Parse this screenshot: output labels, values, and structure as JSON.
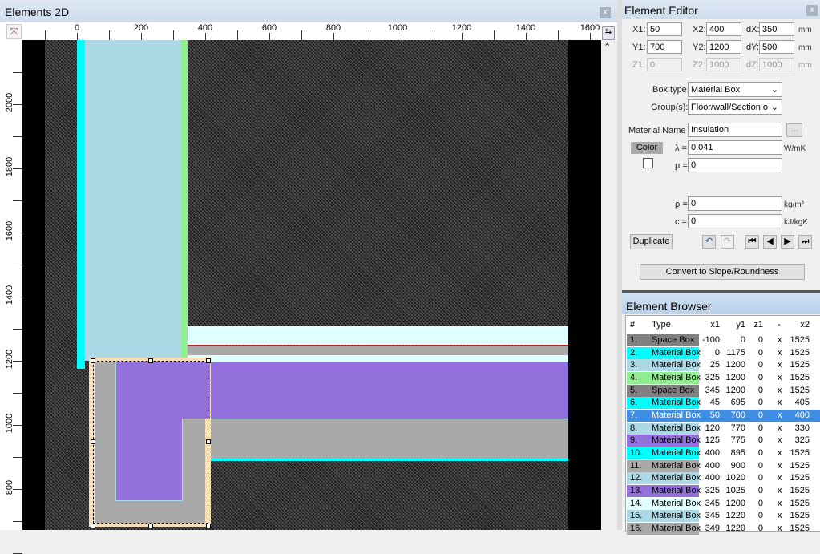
{
  "left_panel": {
    "title": "Elements 2D",
    "close": "x"
  },
  "ruler_x": [
    "0",
    "200",
    "400",
    "600",
    "800",
    "1000",
    "1200",
    "1400",
    "1600"
  ],
  "ruler_y": [
    "2000",
    "1800",
    "1600",
    "1400",
    "1200",
    "1000",
    "800"
  ],
  "editor": {
    "title": "Element Editor",
    "close": "x",
    "x1_label": "X1:",
    "x1": "50",
    "x2_label": "X2:",
    "x2": "400",
    "dx_label": "dX:",
    "dx": "350",
    "y1_label": "Y1:",
    "y1": "700",
    "y2_label": "Y2:",
    "y2": "1200",
    "dy_label": "dY:",
    "dy": "500",
    "z1_label": "Z1:",
    "z1": "0",
    "z2_label": "Z2:",
    "z2": "1000",
    "dz_label": "dZ:",
    "dz": "1000",
    "unit_mm": "mm",
    "box_type_label": "Box type:",
    "box_type": "Material Box",
    "groups_label": "Group(s):",
    "groups": "Floor/wall/Section ove",
    "material_name_label": "Material Name :",
    "material_name": "Insulation",
    "browse": "...",
    "color_button": "Color",
    "lambda_label": "λ =",
    "lambda": "0,041",
    "lambda_unit": "W/mK",
    "mu_label": "μ =",
    "mu": "0",
    "rho_label": "ρ =",
    "rho": "0",
    "rho_unit": "kg/m³",
    "c_label": "c =",
    "c": "0",
    "c_unit": "kJ/kgK",
    "duplicate": "Duplicate",
    "convert": "Convert to Slope/Roundness"
  },
  "browser": {
    "title": "Element Browser",
    "headers": [
      "#",
      "Type",
      "x1",
      "y1",
      "z1",
      "-",
      "x2"
    ],
    "rows": [
      {
        "n": "1.",
        "type": "Space Box",
        "x1": "-100",
        "y1": "0",
        "z1": "0",
        "s": "x",
        "x2": "1525",
        "color": "#808080"
      },
      {
        "n": "2.",
        "type": "Material Box",
        "x1": "0",
        "y1": "1175",
        "z1": "0",
        "s": "x",
        "x2": "1525",
        "color": "#00ffff"
      },
      {
        "n": "3.",
        "type": "Material Box",
        "x1": "25",
        "y1": "1200",
        "z1": "0",
        "s": "x",
        "x2": "1525",
        "color": "#add8e6"
      },
      {
        "n": "4.",
        "type": "Material Box",
        "x1": "325",
        "y1": "1200",
        "z1": "0",
        "s": "x",
        "x2": "1525",
        "color": "#90ee90"
      },
      {
        "n": "5.",
        "type": "Space Box",
        "x1": "345",
        "y1": "1200",
        "z1": "0",
        "s": "x",
        "x2": "1525",
        "color": "#808080"
      },
      {
        "n": "6.",
        "type": "Material Box",
        "x1": "45",
        "y1": "695",
        "z1": "0",
        "s": "x",
        "x2": "405",
        "color": "#00ffff"
      },
      {
        "n": "7.",
        "type": "Material Box",
        "x1": "50",
        "y1": "700",
        "z1": "0",
        "s": "x",
        "x2": "400",
        "color": "#3f8ee6",
        "selected": true
      },
      {
        "n": "8.",
        "type": "Material Box",
        "x1": "120",
        "y1": "770",
        "z1": "0",
        "s": "x",
        "x2": "330",
        "color": "#add8e6"
      },
      {
        "n": "9.",
        "type": "Material Box",
        "x1": "125",
        "y1": "775",
        "z1": "0",
        "s": "x",
        "x2": "325",
        "color": "#9370db"
      },
      {
        "n": "10.",
        "type": "Material Box",
        "x1": "400",
        "y1": "895",
        "z1": "0",
        "s": "x",
        "x2": "1525",
        "color": "#00ffff"
      },
      {
        "n": "11.",
        "type": "Material Box",
        "x1": "400",
        "y1": "900",
        "z1": "0",
        "s": "x",
        "x2": "1525",
        "color": "#a9a9a9"
      },
      {
        "n": "12.",
        "type": "Material Box",
        "x1": "400",
        "y1": "1020",
        "z1": "0",
        "s": "x",
        "x2": "1525",
        "color": "#add8e6"
      },
      {
        "n": "13.",
        "type": "Material Box",
        "x1": "325",
        "y1": "1025",
        "z1": "0",
        "s": "x",
        "x2": "1525",
        "color": "#9370db"
      },
      {
        "n": "14.",
        "type": "Material Box",
        "x1": "345",
        "y1": "1200",
        "z1": "0",
        "s": "x",
        "x2": "1525",
        "color": "#e0ffff"
      },
      {
        "n": "15.",
        "type": "Material Box",
        "x1": "345",
        "y1": "1220",
        "z1": "0",
        "s": "x",
        "x2": "1525",
        "color": "#add8e6"
      },
      {
        "n": "16.",
        "type": "Material Box",
        "x1": "349",
        "y1": "1220",
        "z1": "0",
        "s": "x",
        "x2": "1525",
        "color": "#a9a9a9"
      }
    ]
  }
}
